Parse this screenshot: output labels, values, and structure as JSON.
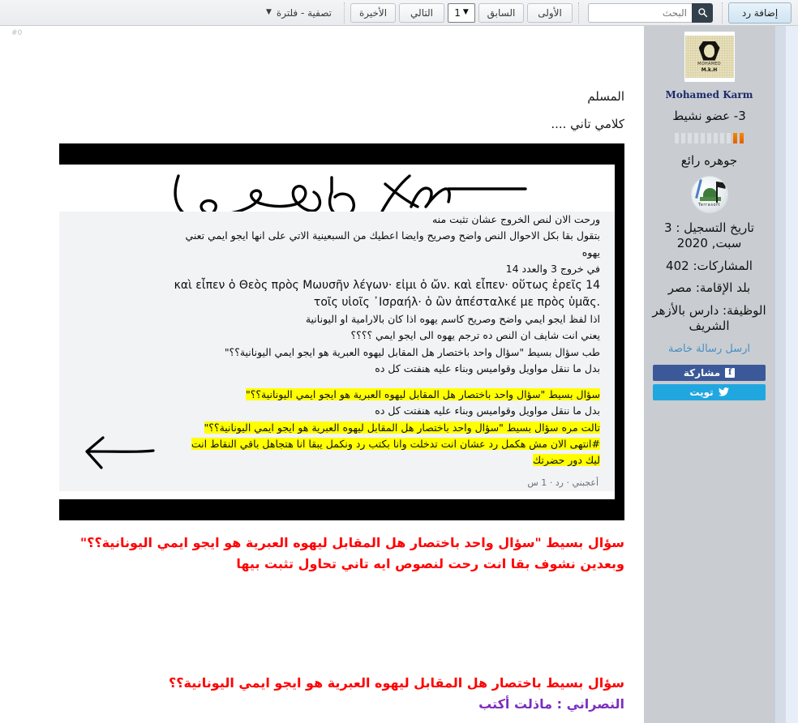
{
  "toolbar": {
    "reply_button": "إضافة رد",
    "search": {
      "value": "",
      "placeholder": "البحث",
      "icon": "search-icon"
    },
    "pagination": {
      "first": "الأولى",
      "prev": "السابق",
      "page_value": "1",
      "next": "التالي",
      "last": "الأخيرة",
      "caret_icon": "chevron-down-icon"
    },
    "filter": {
      "label": "تصفية - فلترة",
      "caret_icon": "chevron-down-icon"
    }
  },
  "post": {
    "number": "#0",
    "lines": [
      "المسلم",
      "كلامي تاني ...."
    ]
  },
  "screenshot": {
    "alt": "لقطة شاشة محادثة",
    "paragraphs": [
      "ورحت الان لنص الخروج عشان تثبت منه",
      "بتقول بقا بكل الاحوال النص واضح وصريح وايضا اعطيك من السبعينية الاتي على انها ايجو ايمي تعني",
      "يهوه",
      "في خروج 3 والعدد 14"
    ],
    "greek": [
      "καὶ εἶπεν ὁ Θεὸς πρὸς Μωυσῆν λέγων· εἰμι ὁ ὤν. καὶ εἶπεν· οὕτως ἐρεῖς 14",
      "τοῖς υἱοῖς ᾿Ισραήλ· ὁ ὢν ἀπέσταλκέ με πρὸς ὑμᾶς."
    ],
    "paragraphs2": [
      "اذا لفظ ايجو ايمي واضح وصريح كاسم يهوه اذا كان بالارامية او اليونانية",
      "يعني انت شايف ان النص ده ترجم يهوه الى ايجو ايمي ؟؟؟؟",
      "طب سؤال بسيط \"سؤال واحد باختصار هل المقابل ليهوه العبرية هو ايجو ايمي اليونانية؟؟\"",
      "بدل ما ننقل مواويل وقواميس وبناء عليه هنفتت كل ده"
    ],
    "highlighted": [
      "سؤال بسيط \"سؤال واحد باختصار هل المقابل ليهوه العبرية هو ايجو ايمي اليونانية؟؟\"",
      "تالت مره سؤال بسيط \"سؤال واحد باختصار هل المقابل ليهوه العبرية هو ايجو ايمي اليونانية؟؟\"",
      "#انتهى الان مش هكمل رد عشان انت تدخلت وانا بكتب رد ونكمل يبقا انا هتجاهل باقي النقاط انت",
      "ليك دور حضرتك"
    ],
    "plain_between": "بدل ما ننقل مواويل وقواميس وبناء عليه هنفتت كل ده",
    "footer": "أعجبني · رد · 1 س"
  },
  "red_block_1": [
    "سؤال بسيط \"سؤال واحد باختصار هل المقابل ليهوه العبرية هو ايجو ايمي اليونانية؟؟\"",
    "وبعدين نشوف بقا انت رحت لنصوص ايه تاني تحاول تثبت بيها"
  ],
  "red_block_2": {
    "line1": "سؤال بسيط باختصار هل المقابل ليهوه العبرية هو ايجو ايمي اليونانية؟؟",
    "line2": "النصراني : ماذلت أكتب"
  },
  "sidebar": {
    "avatar": {
      "icon": "user-avatar",
      "caption": "MOHAMED",
      "caption2": "M.k.H"
    },
    "username": "Mohamed Karm",
    "rank": "3- عضو نشيط",
    "rank_bars": {
      "total": 11,
      "filled": 2,
      "filled_color": "#e85c00",
      "empty_color": "#dcdfe1"
    },
    "title": "جوهره رائع",
    "medal": {
      "icon": "mosque-medal-icon",
      "caption": "Terrasoft"
    },
    "fields": [
      "تاريخ التسجيل : 3 سبت, 2020",
      "المشاركات: 402",
      "بلد الإقامة: مصر",
      "الوظيفة: دارس بالأزهر الشريف"
    ],
    "private_message": "ارسل رسالة خاصة",
    "social": [
      {
        "label": "مشاركة",
        "icon": "facebook-icon",
        "color": "#3b5998",
        "glyph": "f"
      },
      {
        "label": "تويت",
        "icon": "twitter-icon",
        "color": "#21a7e0",
        "glyph": "🐦"
      }
    ]
  },
  "colors": {
    "red": "#ff0000",
    "purple": "#7b2fbe",
    "highlight": "#ffff00",
    "sidebar_bg": "#c9cdd1",
    "name": "#1b2a6b"
  }
}
